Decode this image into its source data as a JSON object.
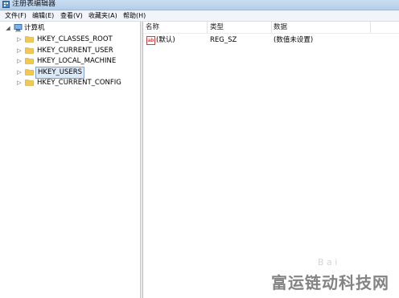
{
  "window": {
    "title": "注册表编辑器"
  },
  "menu": [
    {
      "label": "文件(F)"
    },
    {
      "label": "编辑(E)"
    },
    {
      "label": "查看(V)"
    },
    {
      "label": "收藏夹(A)"
    },
    {
      "label": "帮助(H)"
    }
  ],
  "tree": {
    "root": {
      "label": "计算机",
      "icon": "computer-icon",
      "expander": "◢"
    },
    "items": [
      {
        "label": "HKEY_CLASSES_ROOT",
        "icon": "folder-icon",
        "expander": "▷"
      },
      {
        "label": "HKEY_CURRENT_USER",
        "icon": "folder-icon",
        "expander": "▷"
      },
      {
        "label": "HKEY_LOCAL_MACHINE",
        "icon": "folder-icon",
        "expander": "▷"
      },
      {
        "label": "HKEY_USERS",
        "icon": "folder-icon",
        "expander": "▷",
        "selected": true
      },
      {
        "label": "HKEY_CURRENT_CONFIG",
        "icon": "folder-icon",
        "expander": "▷"
      }
    ]
  },
  "list": {
    "columns": [
      "名称",
      "类型",
      "数据"
    ],
    "rows": [
      {
        "icon": "string-value-icon",
        "name": "(默认)",
        "type": "REG_SZ",
        "data": "(数值未设置)"
      }
    ]
  },
  "watermark": {
    "text": "富运链动科技网",
    "mid_text": "B a i"
  },
  "colors": {
    "selection": "#dce9f8",
    "selection_border": "#7da2ce",
    "titlebar": "#c9def2",
    "folder": "#f2c94c"
  }
}
